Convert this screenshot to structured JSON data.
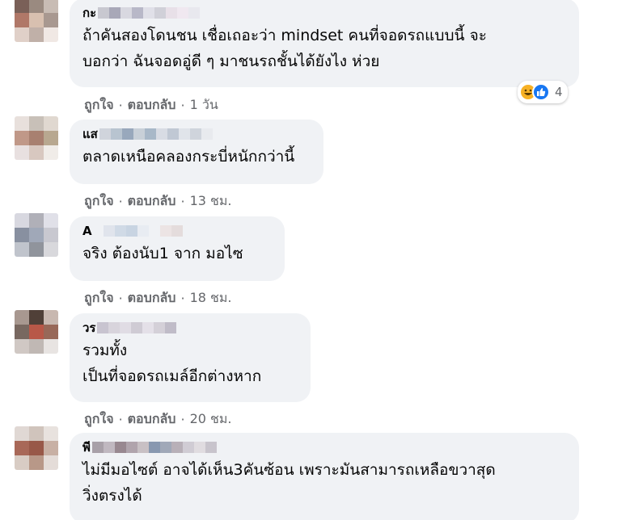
{
  "comments": [
    {
      "author": "กะ",
      "lines": [
        "ถ้าคันสองโดนชน เชื่อเถอะว่า mindset คนที่จอดรถแบบนี้ จะ",
        "บอกว่า ฉันจอดอู่ดี ๆ มาชนรถชั้นได้ยังไง ห่วย"
      ],
      "like": "ถูกใจ",
      "reply": "ตอบกลับ",
      "time": "1 วัน",
      "reaction_count": "4"
    },
    {
      "author": "แส",
      "lines": [
        "ตลาดเหนือคลองกระบี่หนักกว่านี้"
      ],
      "like": "ถูกใจ",
      "reply": "ตอบกลับ",
      "time": "13 ชม."
    },
    {
      "author": "A",
      "lines": [
        "จริง ต้องนับ1 จาก มอไซ"
      ],
      "like": "ถูกใจ",
      "reply": "ตอบกลับ",
      "time": "18 ชม."
    },
    {
      "author": "วร",
      "lines": [
        "รวมทั้ง",
        "เป็นที่จอดรถเมล์อีกต่างหาก"
      ],
      "like": "ถูกใจ",
      "reply": "ตอบกลับ",
      "time": "20 ชม."
    },
    {
      "author": "พี",
      "lines": [
        "ไม่มีมอไซต์ อาจได้เห็น3คันซ้อน เพราะมันสามารถเหลือขวาสุด",
        "วิ่งตรงได้"
      ]
    }
  ],
  "separator": "·",
  "icons": {
    "haha": "haha-reaction-icon",
    "like": "like-reaction-icon"
  },
  "colors": {
    "bubble": "#f0f2f5",
    "meta_text": "#65676b",
    "like_blue": "#1877f2",
    "haha_yellow": "#f7b125"
  }
}
